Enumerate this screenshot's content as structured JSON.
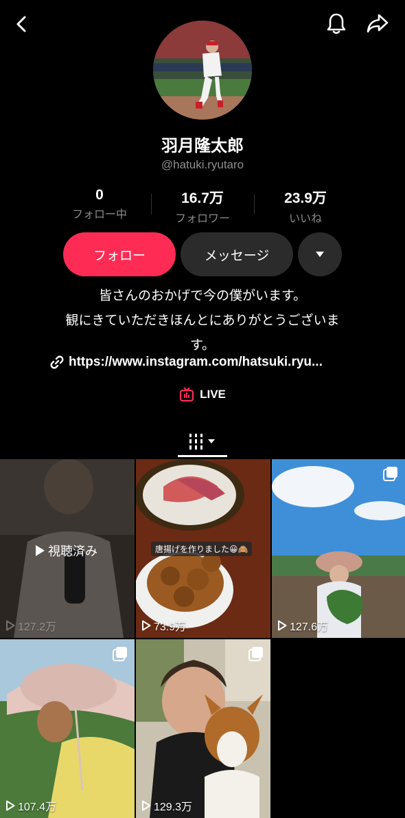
{
  "profile": {
    "name": "羽月隆太郎",
    "handle": "@hatuki.ryutaro"
  },
  "stats": [
    {
      "value": "0",
      "label": "フォロー中"
    },
    {
      "value": "16.7万",
      "label": "フォロワー"
    },
    {
      "value": "23.9万",
      "label": "いいね"
    }
  ],
  "buttons": {
    "follow": "フォロー",
    "message": "メッセージ"
  },
  "bio": {
    "line1": "皆さんのおかげで今の僕がいます。",
    "line2": "観にきていただきほんとにありがとうございま",
    "line3": "す。"
  },
  "link": "https://www.instagram.com/hatsuki.ryu...",
  "live_label": "LIVE",
  "videos": [
    {
      "views": "127.2万",
      "overlay": "視聴済み"
    },
    {
      "views": "73.9万",
      "caption": "唐揚げを作りました😀🙈"
    },
    {
      "views": "127.6万"
    },
    {
      "views": "107.4万"
    },
    {
      "views": "129.3万"
    }
  ],
  "colors": {
    "accent": "#fe2c55",
    "secondary_button": "#2b2b2b",
    "muted_text": "#8f8f8f"
  },
  "icons": [
    "back-icon",
    "bell-icon",
    "share-icon",
    "link-icon",
    "live-icon",
    "grid-icon",
    "play-icon",
    "multi-photo-icon"
  ]
}
